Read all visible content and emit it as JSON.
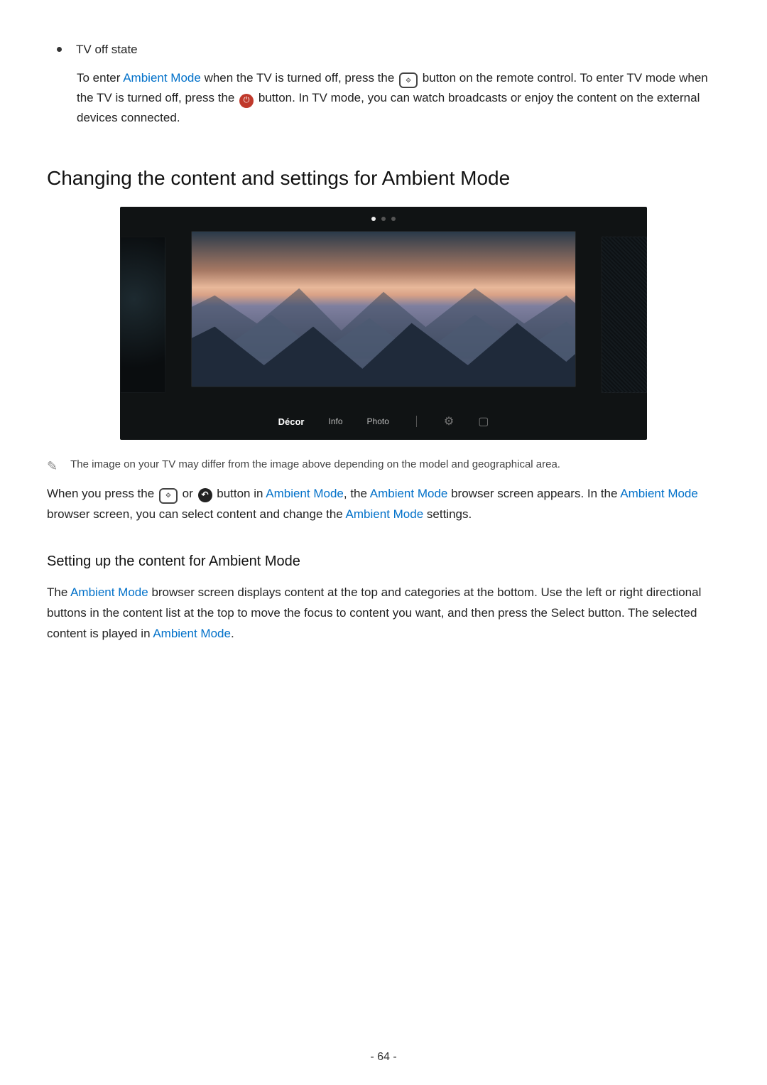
{
  "bullet": {
    "title": "TV off state",
    "body_before": "To enter ",
    "ambient1": "Ambient Mode",
    "body_mid1": " when the TV is turned off, press the ",
    "body_mid2": " button on the remote control. To enter TV mode when the TV is turned off, press the ",
    "body_mid3": " button. In TV mode, you can watch broadcasts or enjoy the content on the external devices connected."
  },
  "heading": "Changing the content and settings for Ambient Mode",
  "tv": {
    "menu": {
      "decor": "Décor",
      "info": "Info",
      "photo": "Photo"
    }
  },
  "note": "The image on your TV may differ from the image above depending on the model and geographical area.",
  "para1": {
    "t1": "When you press the ",
    "t2": " or ",
    "t3": " button in ",
    "am1": "Ambient Mode",
    "t4": ", the ",
    "am2": "Ambient Mode",
    "t5": " browser screen appears. In the ",
    "am3": "Ambient Mode",
    "t6": " browser screen, you can select content and change the ",
    "am4": "Ambient Mode",
    "t7": " settings."
  },
  "subheading": "Setting up the content for Ambient Mode",
  "para2": {
    "t1": "The ",
    "am1": "Ambient Mode",
    "t2": " browser screen displays content at the top and categories at the bottom. Use the left or right directional buttons in the content list at the top to move the focus to content you want, and then press the Select button. The selected content is played in ",
    "am2": "Ambient Mode",
    "t3": "."
  },
  "page_number": "- 64 -"
}
